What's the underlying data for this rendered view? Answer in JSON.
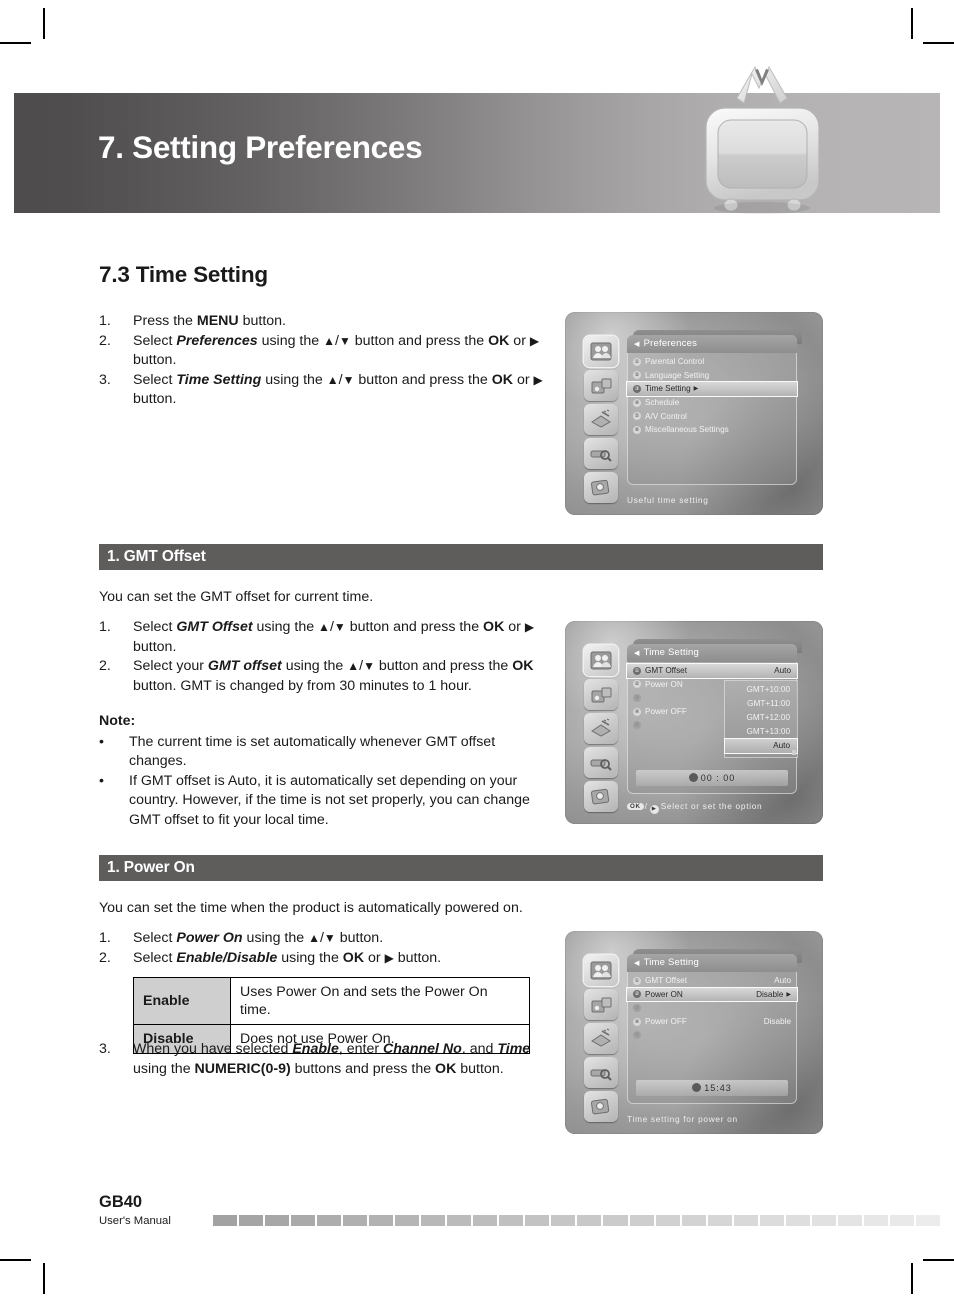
{
  "banner": {
    "title": "7. Setting Preferences",
    "tv_icon": "retro-tv-icon"
  },
  "section": {
    "title": "7.3 Time Setting"
  },
  "intro_steps": [
    {
      "num": "1.",
      "html": "Press the <span class=\"b\">MENU</span> button."
    },
    {
      "num": "2.",
      "html": "Select <span class=\"bi\">Preferences</span> using the <span class=\"arr\">▲</span>/<span class=\"arr\">▼</span> button and press the <span class=\"b\">OK</span> or <span class=\"arr\">▶</span> button."
    },
    {
      "num": "3.",
      "html": "Select <span class=\"bi\">Time Setting</span> using the <span class=\"arr\">▲</span>/<span class=\"arr\">▼</span> button and press the <span class=\"b\">OK</span> or <span class=\"arr\">▶</span> button."
    }
  ],
  "gmt": {
    "bar_label": "1. GMT Offset",
    "intro": "You can set the GMT offset for current time.",
    "steps": [
      {
        "num": "1.",
        "html": "Select <span class=\"bi\">GMT Offset</span> using the <span class=\"arr\">▲</span>/<span class=\"arr\">▼</span> button and press the <span class=\"b\">OK</span> or <span class=\"arr\">▶</span> button."
      },
      {
        "num": "2.",
        "html": "Select your <span class=\"bi\">GMT offset</span> using the <span class=\"arr\">▲</span>/<span class=\"arr\">▼</span> button and press the <span class=\"b\">OK</span> button. GMT is changed by from 30 minutes to 1 hour."
      }
    ],
    "note_heading": "Note:",
    "notes": [
      "The current time is set automatically whenever GMT offset changes.",
      "If GMT offset is Auto, it is automatically set depending on your country. However, if the time is not set properly, you can change GMT offset to fit your local time."
    ]
  },
  "power_on": {
    "bar_label": "1. Power On",
    "intro": "You can set the time when the product is automatically powered on.",
    "steps": [
      {
        "num": "1.",
        "html": "Select <span class=\"bi\">Power On</span> using the <span class=\"arr\">▲</span>/<span class=\"arr\">▼</span> button."
      },
      {
        "num": "2.",
        "html": "Select <span class=\"bi\">Enable/Disable</span> using the <span class=\"b\">OK</span> or <span class=\"arr\">▶</span> button."
      }
    ],
    "table": [
      {
        "key": "Enable",
        "desc": "Uses Power On and sets the Power On time."
      },
      {
        "key": "Disable",
        "desc": "Does not use Power On."
      }
    ],
    "final_step": {
      "num": "3.",
      "html": "When you have selected <span class=\"bi\">Enable</span>, enter <span class=\"bi\">Channel No</span>. and <span class=\"bi\">Time</span> using the <span class=\"b\">NUMERIC(0-9)</span> buttons and press the <span class=\"b\">OK</span> button."
    }
  },
  "osd1": {
    "panel_title": "Preferences",
    "back_arrow": "◀",
    "items": [
      {
        "n": "①",
        "label": "Parental Control",
        "selected": false
      },
      {
        "n": "②",
        "label": "Language Setting",
        "selected": false
      },
      {
        "n": "③",
        "label": "Time Setting",
        "selected": true,
        "caret": "▶"
      },
      {
        "n": "④",
        "label": "Schedule",
        "selected": false
      },
      {
        "n": "⑤",
        "label": "A/V Control",
        "selected": false
      },
      {
        "n": "⑥",
        "label": "Miscellaneous Settings",
        "selected": false
      }
    ],
    "hint": "Useful time setting"
  },
  "osd2": {
    "panel_title": "Time Setting",
    "back_arrow": "◀",
    "items": [
      {
        "n": "①",
        "label": "GMT Offset",
        "value": "Auto",
        "selected": true,
        "dim": false
      },
      {
        "n": "②",
        "label": "Power ON",
        "value": "",
        "selected": false,
        "dim": false
      },
      {
        "n": "③",
        "label": "",
        "value": "",
        "selected": false,
        "dim": true
      },
      {
        "n": "④",
        "label": "Power OFF",
        "value": "",
        "selected": false,
        "dim": false
      },
      {
        "n": "⑤",
        "label": "",
        "value": "",
        "selected": false,
        "dim": true
      }
    ],
    "dropdown": [
      {
        "label": "GMT+10:00",
        "selected": false
      },
      {
        "label": "GMT+11:00",
        "selected": false
      },
      {
        "label": "GMT+12:00",
        "selected": false
      },
      {
        "label": "GMT+13:00",
        "selected": false
      },
      {
        "label": "Auto",
        "selected": true
      }
    ],
    "clock": "00 : 00",
    "hint_ok": "OK",
    "hint_arrow": "▶",
    "hint_text": "Select or set the option"
  },
  "osd3": {
    "panel_title": "Time Setting",
    "back_arrow": "◀",
    "items": [
      {
        "n": "①",
        "label": "GMT Offset",
        "value": "Auto",
        "selected": false,
        "dim": false
      },
      {
        "n": "②",
        "label": "Power ON",
        "value": "Disable",
        "selected": true,
        "dim": false,
        "caret": "▶"
      },
      {
        "n": "③",
        "label": "",
        "value": "-- : --",
        "selected": false,
        "dim": true
      },
      {
        "n": "④",
        "label": "Power OFF",
        "value": "Disable",
        "selected": false,
        "dim": false
      },
      {
        "n": "⑤",
        "label": "",
        "value": "-- : --",
        "selected": false,
        "dim": true
      }
    ],
    "clock": "15:43",
    "hint": "Time setting for power on"
  },
  "footer": {
    "page": "GB40",
    "subtitle": "User's Manual"
  },
  "colors": {
    "banner_dark": "#4e4c4c",
    "banner_light": "#b7b5b5",
    "section_bar": "#5f5c5c",
    "table_key_bg": "#cfcfcf",
    "text": "#1a1a1a"
  }
}
